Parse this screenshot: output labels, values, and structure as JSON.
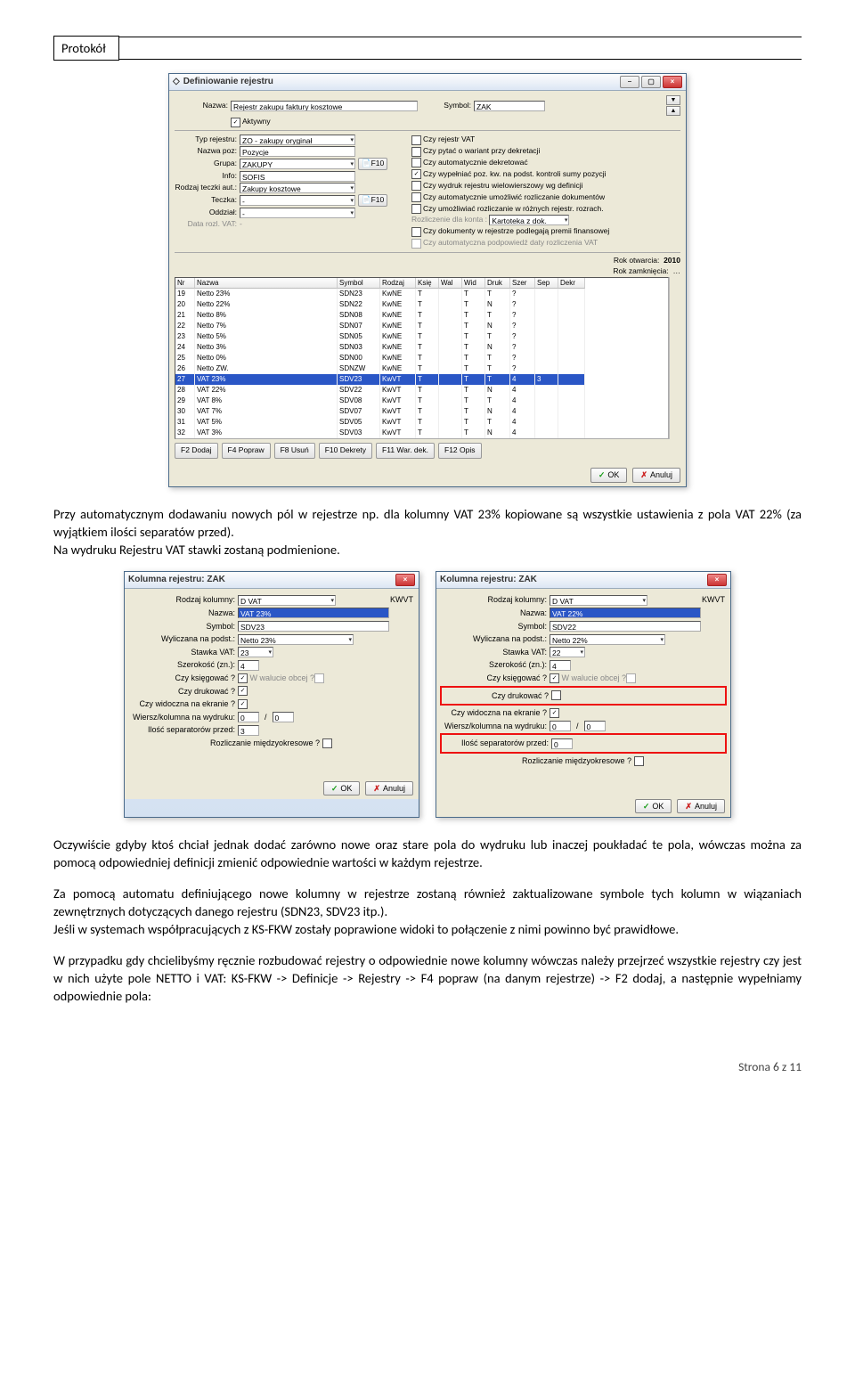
{
  "header": {
    "label": "Protokół"
  },
  "para1": "Przy automatycznym dodawaniu nowych pól w rejestrze np. dla kolumny VAT 23% kopiowane są wszystkie ustawienia z pola VAT 22% (za wyjątkiem ilości separatów przed).",
  "para2": "Na wydruku Rejestru VAT stawki zostaną podmienione.",
  "para3": "Oczywiście gdyby ktoś chciał jednak dodać zarówno nowe oraz stare pola do wydruku lub inaczej poukładać te pola, wówczas można za pomocą odpowiedniej definicji zmienić odpowiednie wartości w każdym rejestrze.",
  "para4a": "Za pomocą automatu definiującego nowe kolumny w rejestrze zostaną również zaktualizowane symbole tych kolumn w wiązaniach zewnętrznych dotyczących danego rejestru (SDN23, SDV23 itp.).",
  "para4b": "Jeśli  w  systemach  współpracujących  z  KS-FKW  zostały  poprawione  widoki  to  połączenie  z  nimi     powinno  być prawidłowe.",
  "para5": "W przypadku gdy chcielibyśmy ręcznie rozbudować rejestry o odpowiednie nowe kolumny wówczas należy przejrzeć wszystkie rejestry czy jest w nich użyte pole NETTO i VAT: KS-FKW -> Definicje -> Rejestry -> F4 popraw (na danym rejestrze) -> F2 dodaj, a następnie wypełniamy odpowiednie pola:",
  "footer": "Strona 6 z 11",
  "dlg1": {
    "title": "Definiowanie rejestru",
    "labels": {
      "nazwa": "Nazwa:",
      "symbol": "Symbol:",
      "aktywny": "Aktywny",
      "typ": "Typ rejestru:",
      "nazwa_poz": "Nazwa poz:",
      "grupa": "Grupa:",
      "info": "Info:",
      "rodzaj_teczki": "Rodzaj teczki aut.:",
      "teczka": "Teczka:",
      "oddzial": "Oddział:",
      "data_rozl": "Data rozl. VAT:",
      "rok_otwarcia": "Rok otwarcia:",
      "rok_zamkniecia": "Rok zamknięcia:",
      "rozl_konta": "Rozliczenie dla konta :",
      "kartoteka": "Kartoteka z dok."
    },
    "vals": {
      "nazwa": "Rejestr zakupu faktury kosztowe",
      "symbol": "ZAK",
      "typ": "ZO - zakupy oryginał",
      "nazwa_poz": "Pozycje",
      "grupa": "ZAKUPY",
      "info": "SOFIS",
      "rodzaj_teczki": "Zakupy kosztowe",
      "teczka": "-",
      "oddzial": "-",
      "data_rozl": "-",
      "rok_otwarcia": "2010",
      "rok_zamkniecia": "…"
    },
    "right_chk": [
      {
        "label": "Czy rejestr VAT",
        "on": false
      },
      {
        "label": "Czy pytać o wariant przy dekretacji",
        "on": false
      },
      {
        "label": "Czy automatycznie dekretować",
        "on": false
      },
      {
        "label": "Czy wypełniać poz. kw. na podst. kontroli sumy pozycji",
        "on": true
      },
      {
        "label": "Czy wydruk rejestru wielowierszowy wg definicji",
        "on": false
      },
      {
        "label": "Czy automatycznie umożliwić rozliczanie dokumentów",
        "on": false
      },
      {
        "label": "Czy umożliwiać rozliczanie w różnych rejestr. rozrach.",
        "on": false
      }
    ],
    "right_chk2": [
      {
        "label": "Czy dokumenty w rejestrze podlegają premii finansowej",
        "on": false
      },
      {
        "label": "Czy automatyczna podpowiedź daty rozliczenia VAT",
        "on": false,
        "dim": true
      }
    ],
    "thead": [
      "Nr",
      "Nazwa",
      "Symbol",
      "Rodzaj",
      "Księ",
      "Wal",
      "Wid",
      "Druk",
      "Szer",
      "Sep",
      "Dekr"
    ],
    "rows": [
      [
        "19",
        "Netto 23%",
        "SDN23",
        "KwNE",
        "T",
        "",
        "T",
        "T",
        "?",
        "",
        ""
      ],
      [
        "20",
        "Netto 22%",
        "SDN22",
        "KwNE",
        "T",
        "",
        "T",
        "N",
        "?",
        "",
        ""
      ],
      [
        "21",
        "Netto 8%",
        "SDN08",
        "KwNE",
        "T",
        "",
        "T",
        "T",
        "?",
        "",
        ""
      ],
      [
        "22",
        "Netto 7%",
        "SDN07",
        "KwNE",
        "T",
        "",
        "T",
        "N",
        "?",
        "",
        ""
      ],
      [
        "23",
        "Netto 5%",
        "SDN05",
        "KwNE",
        "T",
        "",
        "T",
        "T",
        "?",
        "",
        ""
      ],
      [
        "24",
        "Netto 3%",
        "SDN03",
        "KwNE",
        "T",
        "",
        "T",
        "N",
        "?",
        "",
        ""
      ],
      [
        "25",
        "Netto 0%",
        "SDN00",
        "KwNE",
        "T",
        "",
        "T",
        "T",
        "?",
        "",
        ""
      ],
      [
        "26",
        "Netto ZW.",
        "SDNZW",
        "KwNE",
        "T",
        "",
        "T",
        "T",
        "?",
        "",
        ""
      ],
      [
        "27",
        "VAT 23%",
        "SDV23",
        "KwVT",
        "T",
        "",
        "T",
        "T",
        "4",
        "3",
        ""
      ],
      [
        "28",
        "VAT 22%",
        "SDV22",
        "KwVT",
        "T",
        "",
        "T",
        "N",
        "4",
        "",
        ""
      ],
      [
        "29",
        "VAT 8%",
        "SDV08",
        "KwVT",
        "T",
        "",
        "T",
        "T",
        "4",
        "",
        ""
      ],
      [
        "30",
        "VAT 7%",
        "SDV07",
        "KwVT",
        "T",
        "",
        "T",
        "N",
        "4",
        "",
        ""
      ],
      [
        "31",
        "VAT 5%",
        "SDV05",
        "KwVT",
        "T",
        "",
        "T",
        "T",
        "4",
        "",
        ""
      ],
      [
        "32",
        "VAT 3%",
        "SDV03",
        "KwVT",
        "T",
        "",
        "T",
        "N",
        "4",
        "",
        ""
      ]
    ],
    "selected_row": 8,
    "btns": [
      "F2 Dodaj",
      "F4 Popraw",
      "F8 Usuń",
      "F10 Dekrety",
      "F11 War. dek.",
      "F12 Opis"
    ],
    "ok": "OK",
    "cancel": "Anuluj"
  },
  "dlg2": {
    "title": "Kolumna rejestru: ZAK",
    "labels": {
      "rodzaj": "Rodzaj kolumny:",
      "nazwa": "Nazwa:",
      "symbol": "Symbol:",
      "wylicz": "Wyliczana na podst.:",
      "stawka": "Stawka VAT:",
      "szer": "Szerokość (zn.):",
      "ksieg": "Czy księgować ?",
      "wal": "W walucie obcej ?",
      "druk": "Czy drukować ?",
      "widocz": "Czy widoczna na ekranie ?",
      "wiersz": "Wiersz/kolumna na wydruku:",
      "ilosc": "Ilość separatorów przed:",
      "rozl": "Rozliczanie międzyokresowe ?"
    },
    "left": {
      "rodzaj": "D  VAT",
      "rodzaj_suf": "KWVT",
      "nazwa": "VAT 23%",
      "symbol": "SDV23",
      "wylicz": "Netto 23%",
      "stawka": "23",
      "szer": "4",
      "ksieg": true,
      "druk": true,
      "widocz": true,
      "wiersz1": "0",
      "wiersz2": "0",
      "ilosc": "3"
    },
    "right": {
      "rodzaj": "D  VAT",
      "rodzaj_suf": "KWVT",
      "nazwa": "VAT 22%",
      "symbol": "SDV22",
      "wylicz": "Netto 22%",
      "stawka": "22",
      "szer": "4",
      "ksieg": true,
      "druk": false,
      "widocz": true,
      "wiersz1": "0",
      "wiersz2": "0",
      "ilosc": "0"
    },
    "ok": "OK",
    "cancel": "Anuluj"
  }
}
